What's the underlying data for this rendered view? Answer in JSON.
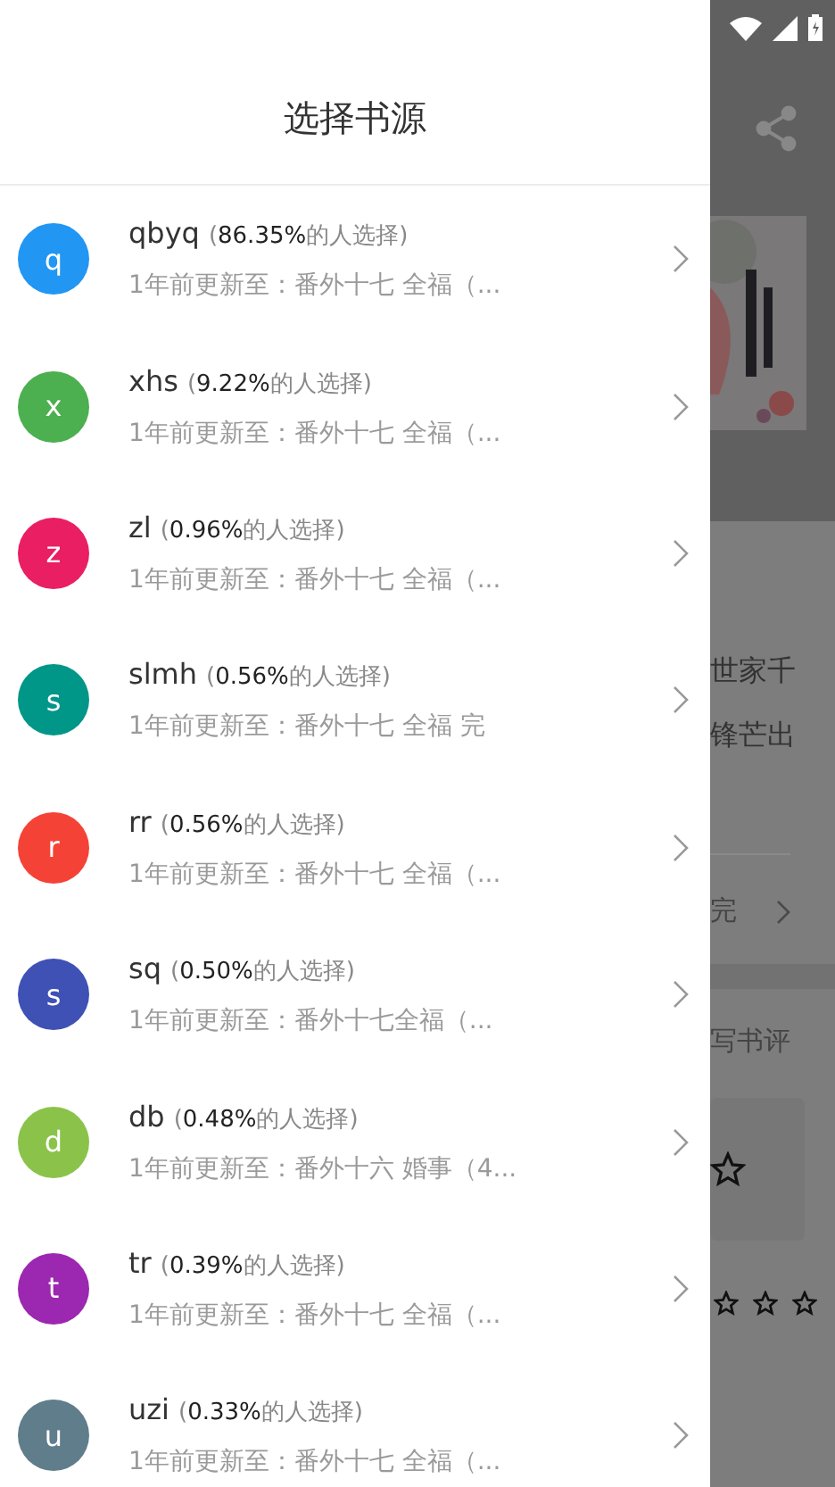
{
  "drawer": {
    "title": "选择书源",
    "sources": [
      {
        "letter": "q",
        "color": "#2196f3",
        "name": "qbyq",
        "open": "(",
        "percent": "86.35%",
        "note": "的人选择)",
        "update": "1年前更新至：番外十七 全福（..."
      },
      {
        "letter": "x",
        "color": "#4caf50",
        "name": "xhs",
        "open": "(",
        "percent": "9.22%",
        "note": "的人选择)",
        "update": "1年前更新至：番外十七 全福（..."
      },
      {
        "letter": "z",
        "color": "#e91e63",
        "name": "zl",
        "open": "(",
        "percent": "0.96%",
        "note": "的人选择)",
        "update": "1年前更新至：番外十七 全福（..."
      },
      {
        "letter": "s",
        "color": "#009688",
        "name": "slmh",
        "open": "(",
        "percent": "0.56%",
        "note": "的人选择)",
        "update": "1年前更新至：番外十七 全福 完"
      },
      {
        "letter": "r",
        "color": "#f44336",
        "name": "rr",
        "open": "(",
        "percent": "0.56%",
        "note": "的人选择)",
        "update": "1年前更新至：番外十七 全福（..."
      },
      {
        "letter": "s",
        "color": "#3f51b5",
        "name": "sq",
        "open": "(",
        "percent": "0.50%",
        "note": "的人选择)",
        "update": "1年前更新至：番外十七全福（..."
      },
      {
        "letter": "d",
        "color": "#8bc34a",
        "name": "db",
        "open": "(",
        "percent": "0.48%",
        "note": "的人选择)",
        "update": "1年前更新至：番外十六 婚事（4..."
      },
      {
        "letter": "t",
        "color": "#9c27b0",
        "name": "tr",
        "open": "(",
        "percent": "0.39%",
        "note": "的人选择)",
        "update": "1年前更新至：番外十七 全福（..."
      },
      {
        "letter": "u",
        "color": "#607d8b",
        "name": "uzi",
        "open": "(",
        "percent": "0.33%",
        "note": "的人选择)",
        "update": "1年前更新至：番外十七 全福（..."
      }
    ]
  },
  "background": {
    "intro_lines": [
      "世家千",
      "锋芒出"
    ],
    "chapter": "完",
    "review_link": "写书评",
    "stars": 0
  }
}
